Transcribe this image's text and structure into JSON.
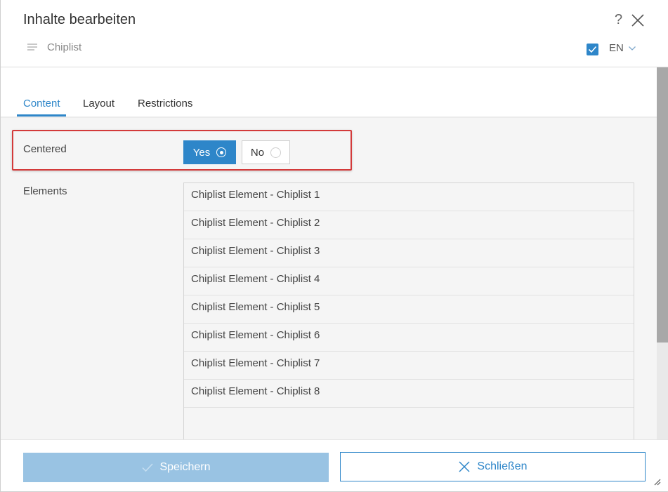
{
  "dialog": {
    "title": "Inhalte bearbeiten",
    "help_label": "?",
    "subtitle": "Chiplist",
    "language": "EN",
    "language_checked": true
  },
  "tabs": [
    {
      "label": "Content",
      "active": true
    },
    {
      "label": "Layout",
      "active": false
    },
    {
      "label": "Restrictions",
      "active": false
    }
  ],
  "form": {
    "centered": {
      "label": "Centered",
      "yes_label": "Yes",
      "no_label": "No",
      "selected": "Yes"
    },
    "elements": {
      "label": "Elements",
      "items": [
        "Chiplist Element - Chiplist 1",
        "Chiplist Element - Chiplist 2",
        "Chiplist Element - Chiplist 3",
        "Chiplist Element - Chiplist 4",
        "Chiplist Element - Chiplist 5",
        "Chiplist Element - Chiplist 6",
        "Chiplist Element - Chiplist 7",
        "Chiplist Element - Chiplist 8"
      ]
    }
  },
  "footer": {
    "save_label": "Speichern",
    "close_label": "Schließen"
  },
  "colors": {
    "accent": "#2e86c9",
    "save_disabled": "#99c3e3",
    "highlight": "#d33a3a"
  }
}
